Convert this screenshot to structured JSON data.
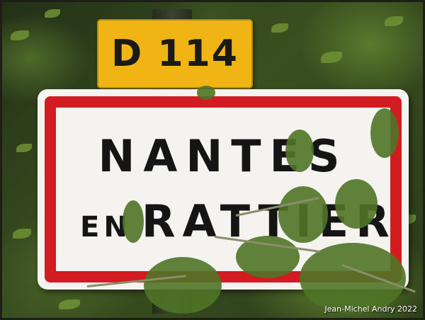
{
  "photo": {
    "subject": "French town entry sign with road number plate",
    "colors": {
      "plate": "#f0b515",
      "border": "#d21c22",
      "sign": "#f4f3f0",
      "foliage": "#4f7426"
    }
  },
  "road_plate": {
    "text": "D 114"
  },
  "town_sign": {
    "line1": "NANTES",
    "line2_small": "EN",
    "line2_large": "RATTIER"
  },
  "credit": {
    "text": "Jean-Michel Andry 2022"
  }
}
